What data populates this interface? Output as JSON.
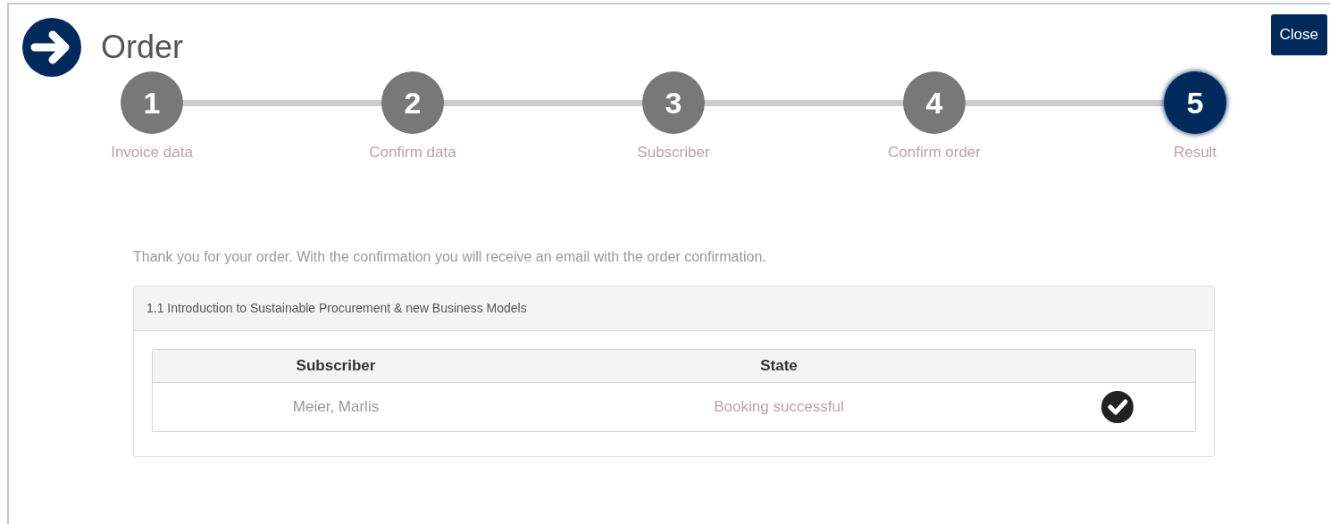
{
  "header": {
    "title": "Order",
    "close_button": "Close"
  },
  "steps": [
    {
      "number": "1",
      "label": "Invoice data",
      "selected": false
    },
    {
      "number": "2",
      "label": "Confirm data",
      "selected": false
    },
    {
      "number": "3",
      "label": "Subscriber",
      "selected": false
    },
    {
      "number": "4",
      "label": "Confirm order",
      "selected": false
    },
    {
      "number": "5",
      "label": "Result",
      "selected": true
    }
  ],
  "message": "Thank you for your order. With the confirmation you will receive an email with the order confirmation.",
  "course": {
    "title": "1.1 Introduction to Sustainable Procurement & new Business Models",
    "table": {
      "columns": [
        "Subscriber",
        "State"
      ],
      "rows": [
        {
          "subscriber": "Meier, Marlis",
          "state": "Booking successful",
          "success": true
        }
      ]
    }
  }
}
